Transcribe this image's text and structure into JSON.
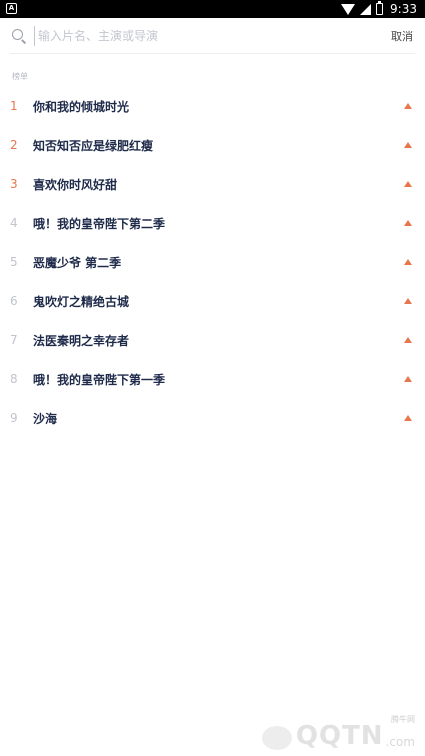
{
  "status_bar": {
    "time": "9:33"
  },
  "search": {
    "placeholder": "输入片名、主演或导演",
    "cancel_label": "取消"
  },
  "section": {
    "label": "榜单"
  },
  "hot_list": [
    {
      "rank": "1",
      "title": "你和我的倾城时光"
    },
    {
      "rank": "2",
      "title": "知否知否应是绿肥红瘦"
    },
    {
      "rank": "3",
      "title": "喜欢你时风好甜"
    },
    {
      "rank": "4",
      "title": "哦！我的皇帝陛下第二季"
    },
    {
      "rank": "5",
      "title": "恶魔少爷 第二季"
    },
    {
      "rank": "6",
      "title": "鬼吹灯之精绝古城"
    },
    {
      "rank": "7",
      "title": "法医秦明之幸存者"
    },
    {
      "rank": "8",
      "title": "哦！我的皇帝陛下第一季"
    },
    {
      "rank": "9",
      "title": "沙海"
    }
  ],
  "watermark": {
    "site_name": "腾牛网",
    "brand": "QQTN",
    "suffix": ".com"
  },
  "colors": {
    "accent": "#e8764c",
    "title_text": "#1e2a4a",
    "muted_rank": "#c0c4cc"
  }
}
